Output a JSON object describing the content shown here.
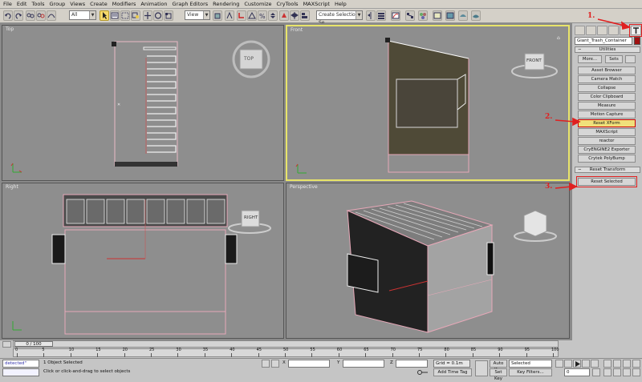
{
  "menu": [
    "File",
    "Edit",
    "Tools",
    "Group",
    "Views",
    "Create",
    "Modifiers",
    "Animation",
    "Graph Editors",
    "Rendering",
    "Customize",
    "CryTools",
    "MAXScript",
    "Help"
  ],
  "toolbar": {
    "filter_value": "All",
    "refcoord_value": "View",
    "selection_set_placeholder": "Create Selection Se"
  },
  "viewports": {
    "top": "Top",
    "front": "Front",
    "left": "Right",
    "perspective": "Perspective",
    "cube_top": "TOP",
    "cube_front": "FRONT",
    "cube_right": "RIGHT"
  },
  "command_panel": {
    "object_name": "Giant_Trash_Container",
    "object_color": "#a01010",
    "utilities_title": "Utilities",
    "more_label": "More...",
    "sets_label": "Sets",
    "utilities": [
      "Asset Browser",
      "Camera Match",
      "Collapse",
      "Color Clipboard",
      "Measure",
      "Motion Capture",
      "Reset XForm",
      "MAXScript",
      "reactor",
      "CryENGINE2 Exporter",
      "Crytek PolyBump"
    ],
    "highlighted_utility": "Reset XForm",
    "reset_transform_title": "Reset Transform",
    "reset_selected_label": "Reset Selected"
  },
  "annotations": [
    "1.",
    "2.",
    "3."
  ],
  "timeline": {
    "slider_text": "0 / 100",
    "ticks": [
      "0",
      "5",
      "10",
      "15",
      "20",
      "25",
      "30",
      "35",
      "40",
      "45",
      "50",
      "55",
      "60",
      "65",
      "70",
      "75",
      "80",
      "85",
      "90",
      "95",
      "100"
    ]
  },
  "status": {
    "listener_text": "detected\"",
    "objects_selected": "1 Object Selected",
    "prompt": "Click or click-and-drag to select objects",
    "x_label": "X",
    "y_label": "Y",
    "z_label": "Z",
    "grid": "Grid = 0.1m",
    "add_time_tag": "Add Time Tag",
    "auto_key": "Auto Key",
    "set_key": "Set Key",
    "key_mode": "Selected",
    "key_filters": "Key Filters...",
    "frame": "0"
  },
  "colors": {
    "accent": "#e8e46a",
    "annotation": "#e02020",
    "highlight": "#f0e07a"
  }
}
